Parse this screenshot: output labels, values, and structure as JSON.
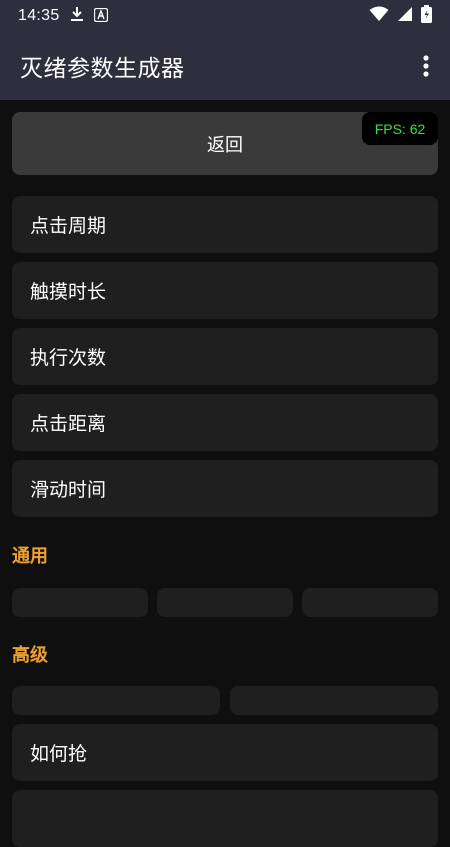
{
  "status_bar": {
    "time": "14:35",
    "icons": [
      "download-icon",
      "a-badge-icon",
      "wifi-icon",
      "battery-icon"
    ]
  },
  "app_bar": {
    "title": "灭绪参数生成器",
    "overflow_icon": "more-vert-icon"
  },
  "back_button": {
    "label": "返回"
  },
  "fps": {
    "text": "FPS: 62"
  },
  "menu": {
    "items": [
      {
        "label": "点击周期"
      },
      {
        "label": "触摸时长"
      },
      {
        "label": "执行次数"
      },
      {
        "label": "点击距离"
      },
      {
        "label": "滑动时间"
      }
    ]
  },
  "sections": {
    "general": {
      "title": "通用",
      "chip_count": 3
    },
    "advanced": {
      "title": "高级",
      "chip_count": 2
    }
  },
  "advanced_items": [
    {
      "label": "如何抢"
    }
  ],
  "colors": {
    "header_bg": "#2e2e3f",
    "page_bg": "#0f0f0f",
    "card_bg": "#1f1f1f",
    "button_bg": "#3a3a3a",
    "section_accent": "#f0a030",
    "fps_text": "#2ee82e"
  }
}
